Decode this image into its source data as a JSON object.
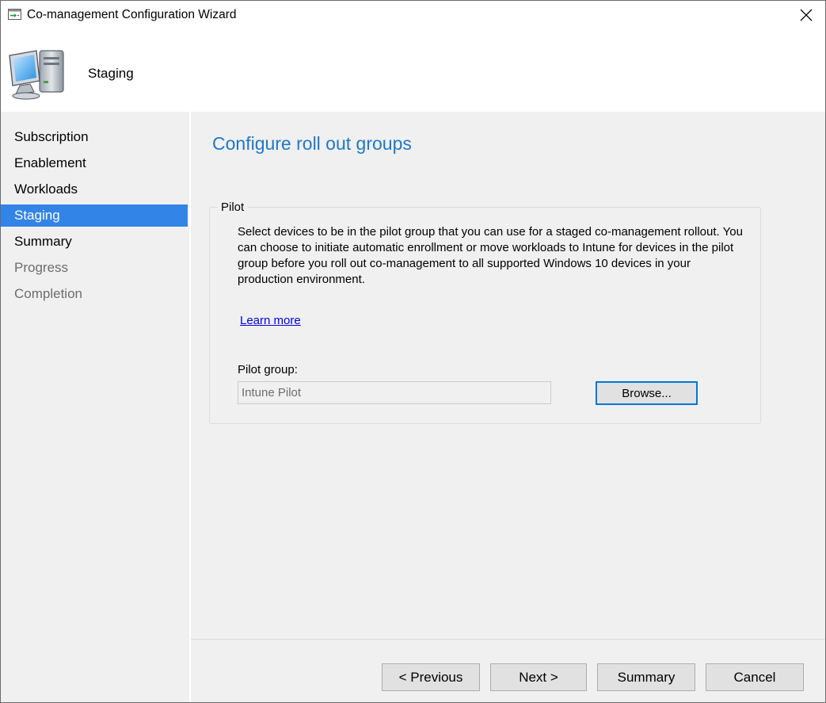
{
  "window": {
    "title": "Co-management Configuration Wizard",
    "close_icon": "close-icon",
    "app_icon": "wizard-app-icon"
  },
  "banner": {
    "title": "Staging",
    "icon": "computer-icon"
  },
  "sidebar": {
    "items": [
      {
        "label": "Subscription",
        "state": "done"
      },
      {
        "label": "Enablement",
        "state": "done"
      },
      {
        "label": "Workloads",
        "state": "done"
      },
      {
        "label": "Staging",
        "state": "active"
      },
      {
        "label": "Summary",
        "state": "done"
      },
      {
        "label": "Progress",
        "state": "pending"
      },
      {
        "label": "Completion",
        "state": "pending"
      }
    ]
  },
  "main": {
    "title": "Configure roll out groups",
    "group": {
      "label": "Pilot",
      "description": "Select devices to be in the pilot group that you can use for a staged co-management rollout. You can choose to initiate automatic enrollment or move workloads to Intune for devices in the pilot group before you roll out co-management to all supported Windows 10 devices in your production environment.",
      "learn_more": "Learn more",
      "pilot_group_label": "Pilot group:",
      "pilot_group_value": "Intune Pilot",
      "browse_label": "Browse..."
    }
  },
  "footer": {
    "previous_label": "< Previous",
    "next_label": "Next >",
    "summary_label": "Summary",
    "cancel_label": "Cancel"
  },
  "colors": {
    "accent": "#3384e7",
    "title_blue": "#1e78c8",
    "link": "#0000ee",
    "panel_bg": "#f0f0f0"
  }
}
